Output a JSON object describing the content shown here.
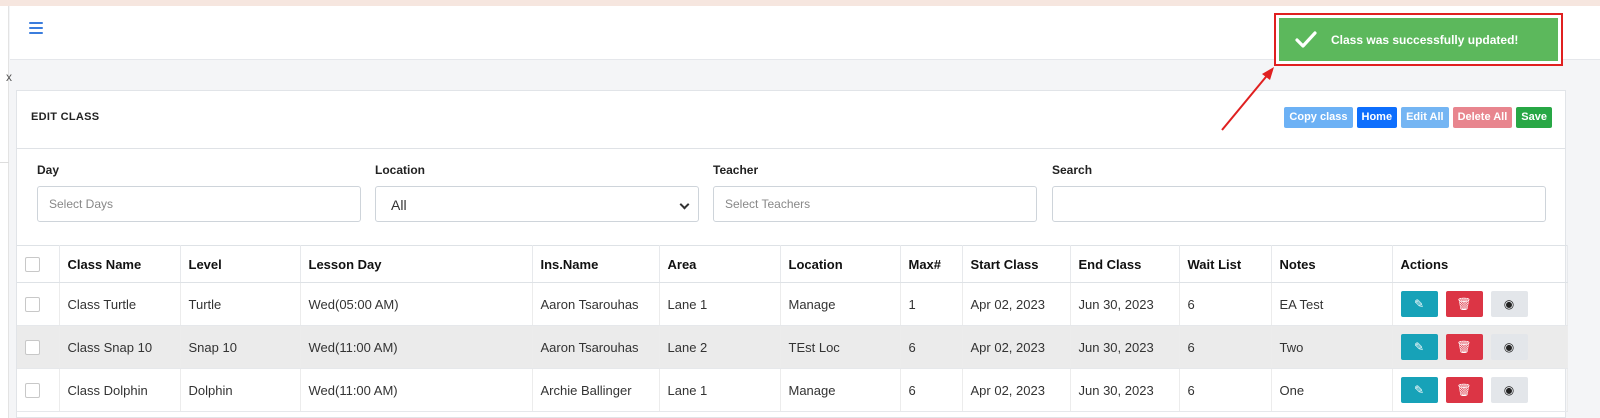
{
  "left_panel": {
    "close_glyph": "x"
  },
  "header": {
    "menu_icon": "hamburger-icon"
  },
  "card": {
    "title": "EDIT CLASS",
    "buttons": {
      "copy": "Copy class",
      "home": "Home",
      "edit_all": "Edit All",
      "delete_all": "Delete All",
      "save": "Save"
    }
  },
  "filters": {
    "day": {
      "label": "Day",
      "placeholder": "Select Days"
    },
    "location": {
      "label": "Location",
      "value": "All"
    },
    "teacher": {
      "label": "Teacher",
      "placeholder": "Select Teachers"
    },
    "search": {
      "label": "Search",
      "value": ""
    }
  },
  "table": {
    "headers": [
      "Class Name",
      "Level",
      "Lesson Day",
      "Ins.Name",
      "Area",
      "Location",
      "Max#",
      "Start Class",
      "End Class",
      "Wait List",
      "Notes",
      "Actions"
    ],
    "rows": [
      [
        "Class Turtle",
        "Turtle",
        "Wed(05:00 AM)",
        "Aaron Tsarouhas",
        "Lane 1",
        "Manage",
        "1",
        "Apr 02, 2023",
        "Jun 30, 2023",
        "6",
        "EA Test"
      ],
      [
        "Class Snap 10",
        "Snap 10",
        "Wed(11:00 AM)",
        "Aaron Tsarouhas",
        "Lane 2",
        "TEst Loc",
        "6",
        "Apr 02, 2023",
        "Jun 30, 2023",
        "6",
        "Two"
      ],
      [
        "Class Dolphin",
        "Dolphin",
        "Wed(11:00 AM)",
        "Archie Ballinger",
        "Lane 1",
        "Manage",
        "6",
        "Apr 02, 2023",
        "Jun 30, 2023",
        "6",
        "One"
      ]
    ]
  },
  "toast": {
    "message": "Class was successfully updated!",
    "icon": "checkmark-icon"
  },
  "colors": {
    "toast_bg": "#5cb85c",
    "highlight": "#e02020",
    "primary": "#0d6efd",
    "save": "#28a745"
  }
}
